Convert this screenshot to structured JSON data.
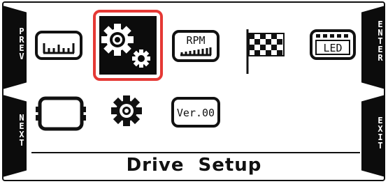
{
  "nav": {
    "prev": "PREV",
    "next": "NEXT",
    "enter": "ENTER",
    "exit": "EXIT"
  },
  "menu": {
    "items": [
      {
        "id": "gauge",
        "icon": "gauge-scale-icon",
        "selected": false
      },
      {
        "id": "drive-setup",
        "icon": "gears-icon",
        "selected": true
      },
      {
        "id": "rpm",
        "icon": "rpm-bar-icon",
        "label": "RPM",
        "selected": false
      },
      {
        "id": "flag",
        "icon": "checkered-flag-icon",
        "selected": false
      },
      {
        "id": "led",
        "icon": "led-display-icon",
        "label": "LED",
        "selected": false
      },
      {
        "id": "display",
        "icon": "display-frame-icon",
        "selected": false
      },
      {
        "id": "settings",
        "icon": "gear-icon",
        "selected": false
      },
      {
        "id": "version",
        "icon": "version-box-icon",
        "label": "Ver.00",
        "selected": false
      }
    ]
  },
  "footer": {
    "title": "Drive Setup"
  },
  "colors": {
    "selection": "#e53935",
    "foreground": "#111111",
    "background": "#ffffff"
  }
}
